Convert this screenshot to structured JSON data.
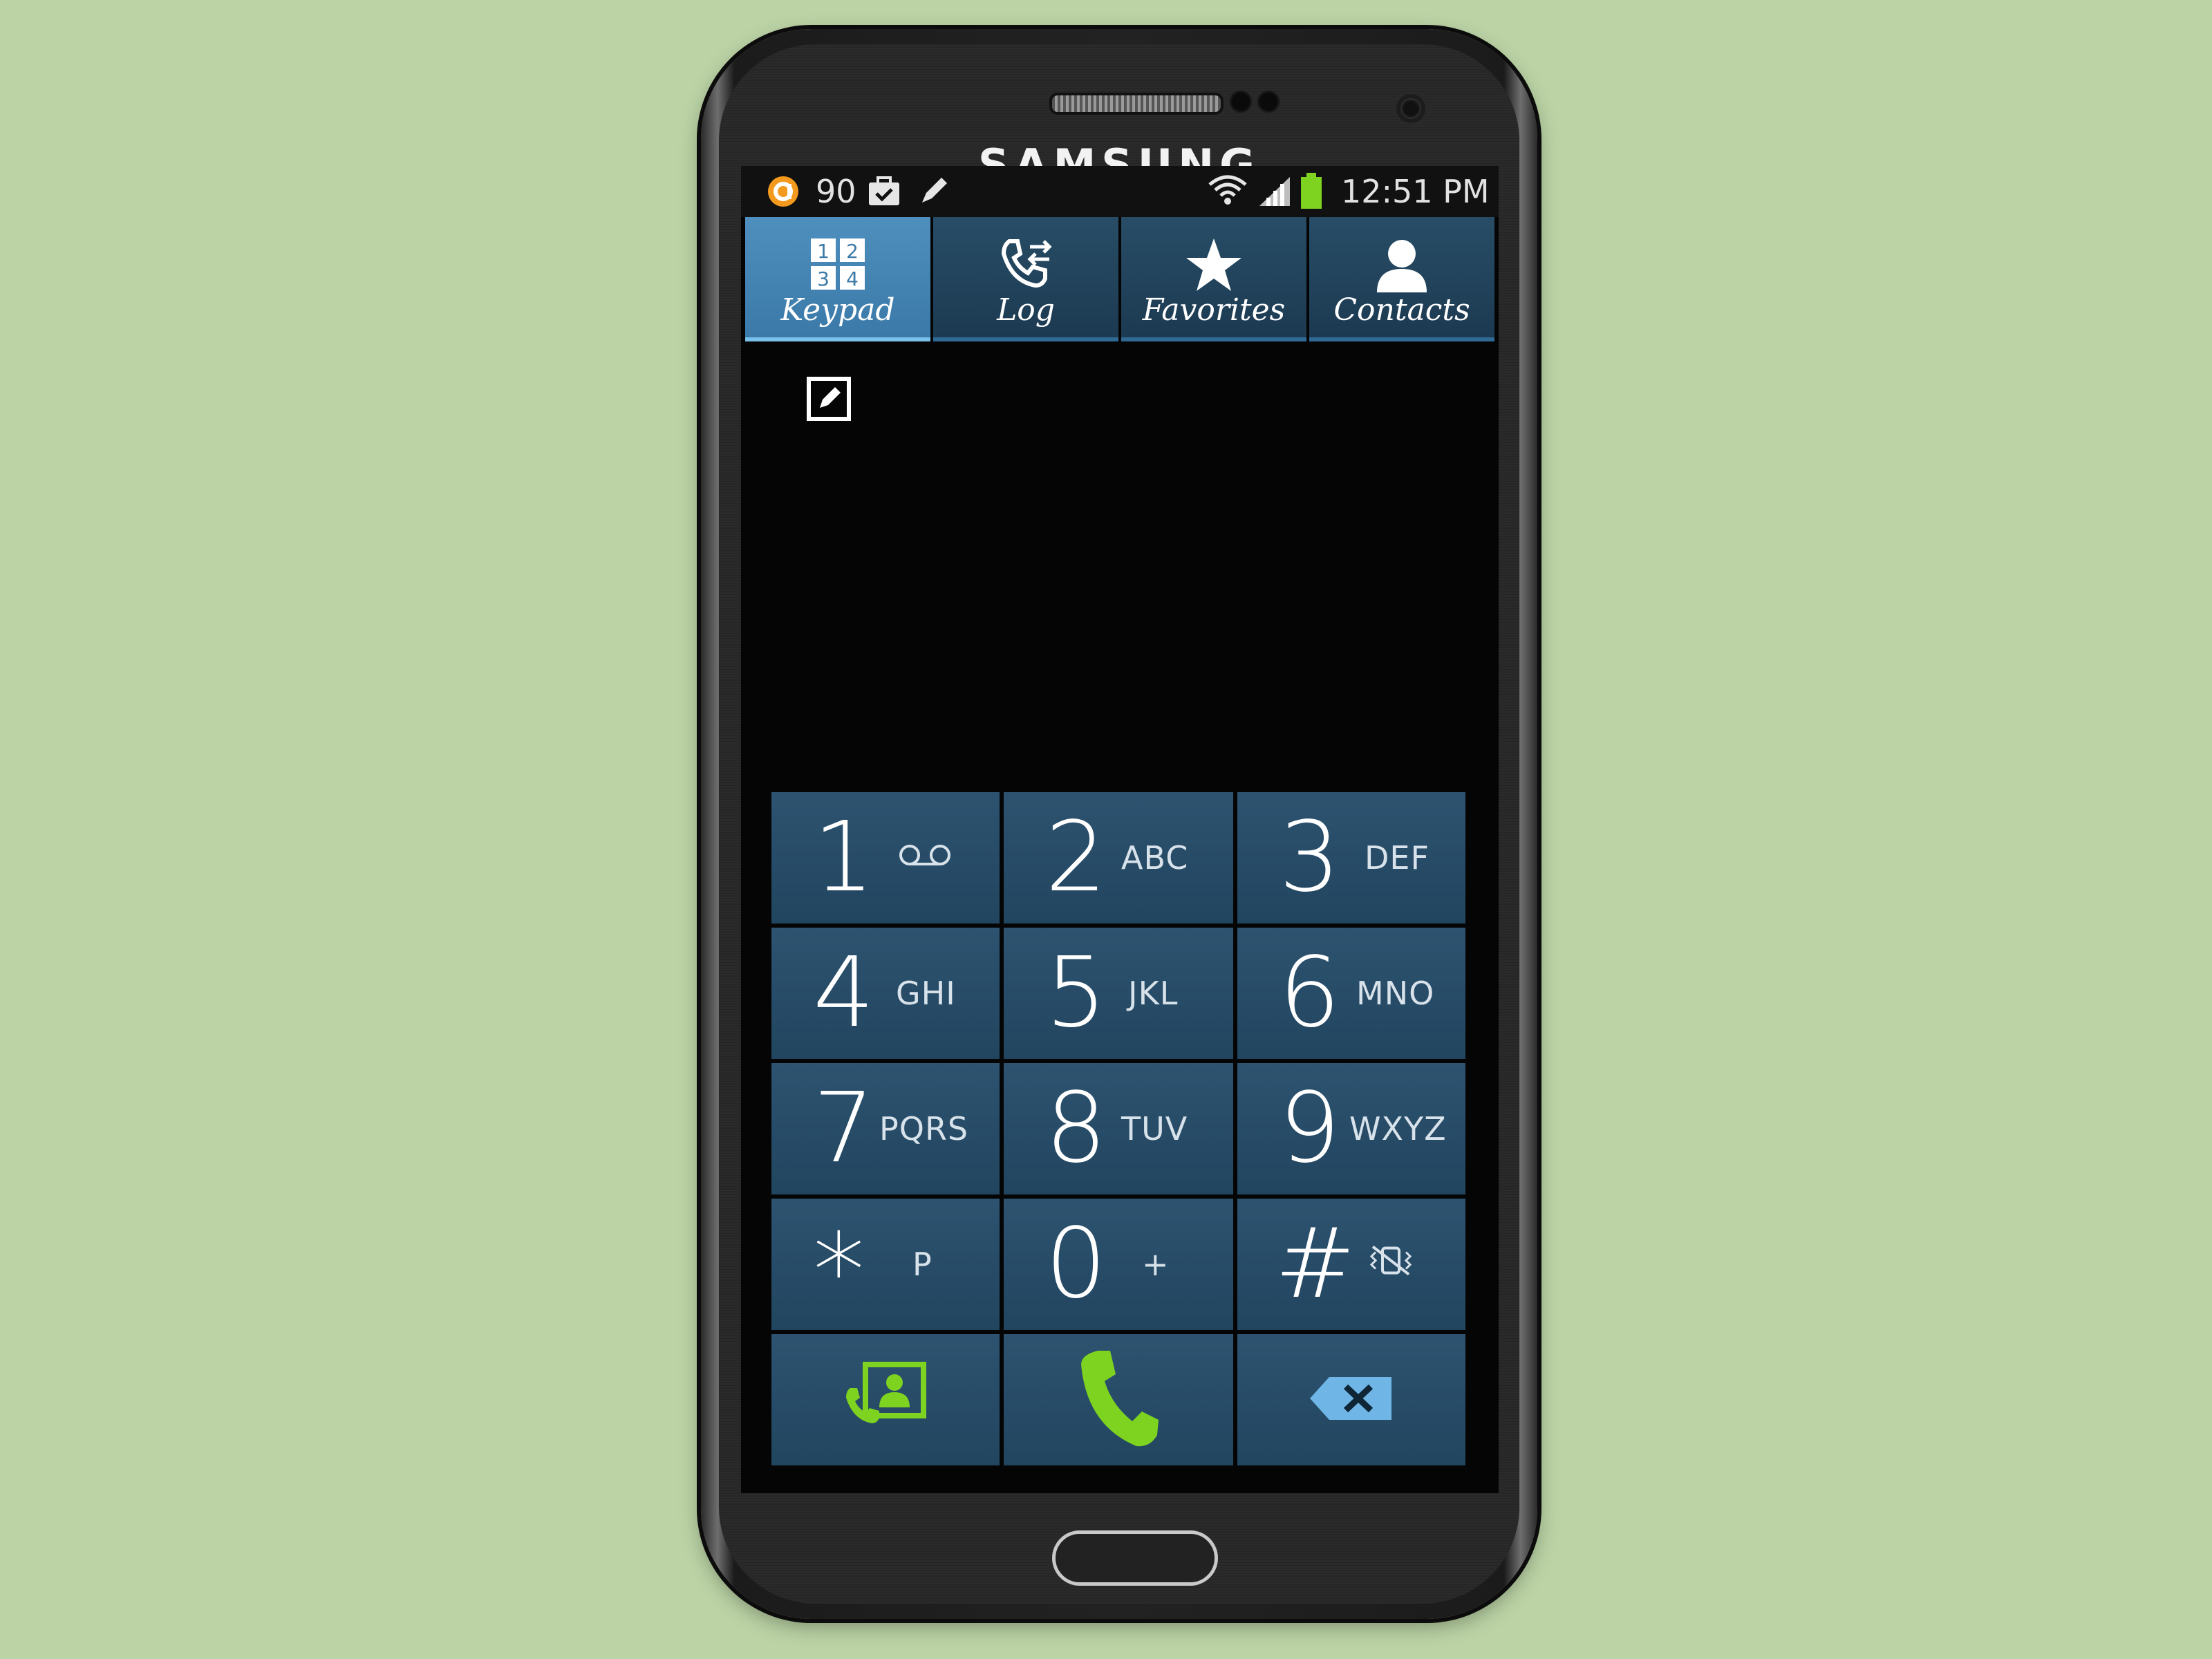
{
  "device": {
    "brand": "SAMSUNG"
  },
  "status_bar": {
    "notification_count": "90",
    "time": "12:51 PM",
    "icons": [
      "app-notification-icon",
      "briefcase-icon",
      "pencil-icon",
      "wifi-icon",
      "signal-icon",
      "battery-icon"
    ]
  },
  "tabs": [
    {
      "label": "Keypad",
      "icon": "keypad-icon",
      "active": true,
      "grid": [
        "1",
        "2",
        "3",
        "4"
      ]
    },
    {
      "label": "Log",
      "icon": "call-log-icon",
      "active": false
    },
    {
      "label": "Favorites",
      "icon": "star-icon",
      "active": false
    },
    {
      "label": "Contacts",
      "icon": "person-icon",
      "active": false
    }
  ],
  "keys": [
    {
      "digit": "1",
      "letters": "",
      "sub_icon": "voicemail-icon"
    },
    {
      "digit": "2",
      "letters": "ABC"
    },
    {
      "digit": "3",
      "letters": "DEF"
    },
    {
      "digit": "4",
      "letters": "GHI"
    },
    {
      "digit": "5",
      "letters": "JKL"
    },
    {
      "digit": "6",
      "letters": "MNO"
    },
    {
      "digit": "7",
      "letters": "PQRS"
    },
    {
      "digit": "8",
      "letters": "TUV"
    },
    {
      "digit": "9",
      "letters": "WXYZ"
    },
    {
      "digit": "*",
      "letters": "P"
    },
    {
      "digit": "0",
      "letters": "+"
    },
    {
      "digit": "#",
      "letters": "",
      "sub_icon": "vibrate-off-icon"
    }
  ],
  "actions": [
    {
      "icon": "contacts-call-icon"
    },
    {
      "icon": "phone-call-icon"
    },
    {
      "icon": "backspace-icon"
    }
  ],
  "colors": {
    "background": "#bbd3a5",
    "tab_active": "#3b7aa8",
    "key": "#2d5370",
    "green": "#7ed321",
    "backspace": "#6fb6e6"
  }
}
